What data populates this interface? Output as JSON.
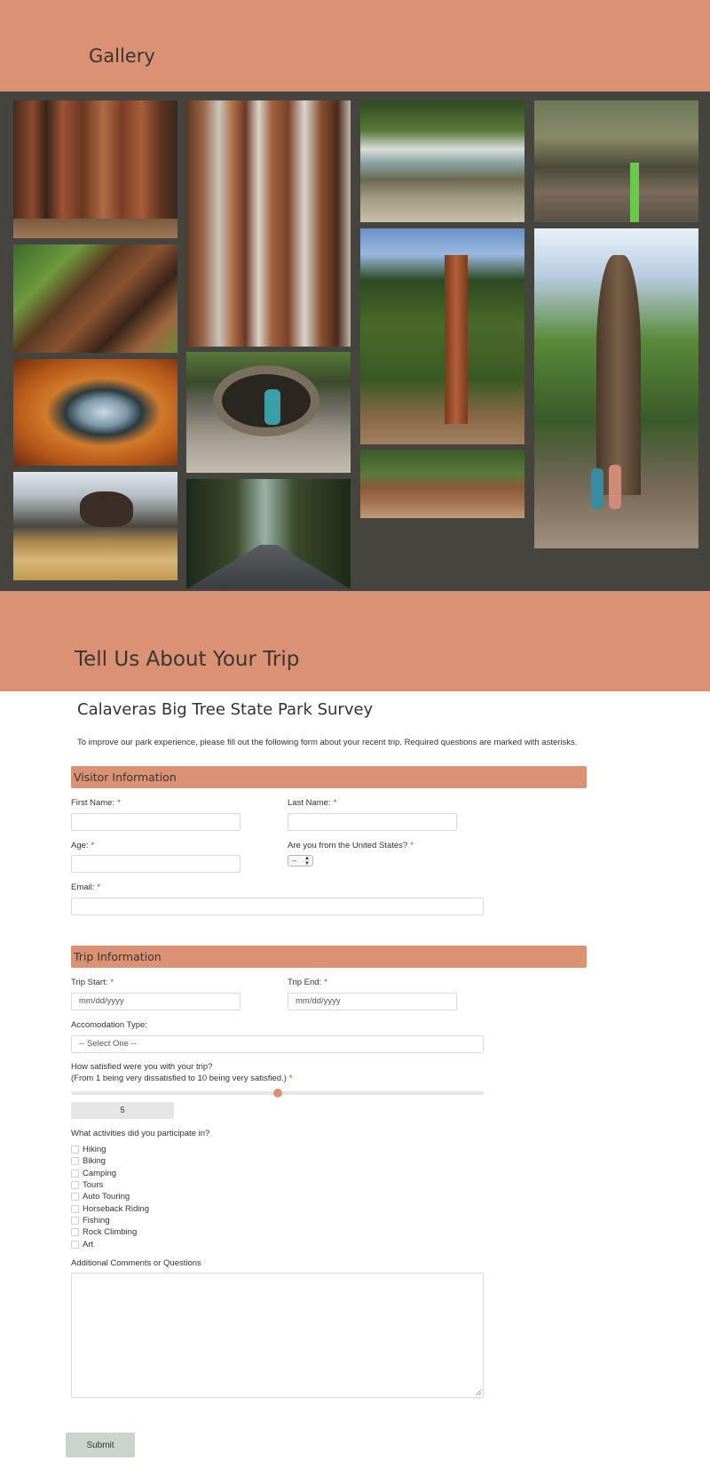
{
  "gallery": {
    "title": "Gallery",
    "photos": [
      {
        "name": "giant-sequoia-trunks-photo"
      },
      {
        "name": "foggy-redwoods-photo"
      },
      {
        "name": "river-rocks-photo"
      },
      {
        "name": "mountain-bike-trail-photo"
      },
      {
        "name": "hollow-tree-tunnel-photo"
      },
      {
        "name": "tent-interior-view-photo"
      },
      {
        "name": "tall-sequoia-forest-photo"
      },
      {
        "name": "couple-under-giant-tree-photo"
      },
      {
        "name": "person-in-hollow-log-photo"
      },
      {
        "name": "dog-in-mountain-lake-photo"
      },
      {
        "name": "forest-road-photo"
      },
      {
        "name": "tree-roots-photo"
      }
    ]
  },
  "trip_header": {
    "title": "Tell Us About Your Trip"
  },
  "survey": {
    "title": "Calaveras Big Tree State Park Survey",
    "intro": "To improve our park experience, please fill out the following form about your recent trip. Required questions are marked with asterisks."
  },
  "visitor": {
    "heading": "Visitor Information",
    "first_name_label": "First Name:",
    "last_name_label": "Last Name:",
    "age_label": "Age:",
    "us_label": "Are you from the United States?",
    "us_value": "--",
    "email_label": "Email:",
    "required_mark": "*"
  },
  "trip": {
    "heading": "Trip Information",
    "start_label": "Trip Start:",
    "start_placeholder": "mm/dd/yyyy",
    "end_label": "Trip End:",
    "end_placeholder": "mm/dd/yyyy",
    "accommodation_label": "Accomodation Type:",
    "accommodation_value": "-- Select One --",
    "satisfaction_label_line1": "How satisfied were you with your trip?",
    "satisfaction_label_line2": "(From 1 being very dissatisfied to 10 being very satisfied.)",
    "satisfaction_value": "5",
    "satisfaction_min": 1,
    "satisfaction_max": 10,
    "accent_color": "#db9173",
    "activities_label": "What activities did you participate in?",
    "activities": [
      "Hiking",
      "Biking",
      "Camping",
      "Tours",
      "Auto Touring",
      "Horseback Riding",
      "Fishing",
      "Rock Climbing",
      "Art"
    ],
    "comments_label": "Additional Comments or Questions"
  },
  "submit_label": "Submit"
}
